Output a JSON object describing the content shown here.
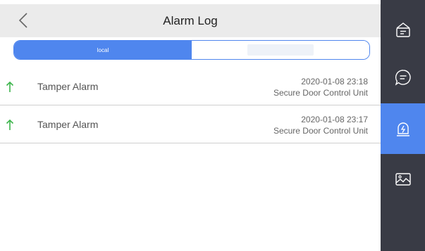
{
  "header": {
    "title": "Alarm Log"
  },
  "tabs": [
    {
      "label": "local",
      "active": true
    },
    {
      "label": "",
      "active": false
    }
  ],
  "alarms": [
    {
      "name": "Tamper Alarm",
      "time": "2020-01-08 23:18",
      "device": "Secure Door Control Unit",
      "icon": "arrow-up-icon"
    },
    {
      "name": "Tamper Alarm",
      "time": "2020-01-08 23:17",
      "device": "Secure Door Control Unit",
      "icon": "arrow-up-icon"
    }
  ],
  "sidebar": {
    "items": [
      {
        "icon": "notice-icon",
        "active": false
      },
      {
        "icon": "message-icon",
        "active": false
      },
      {
        "icon": "alarm-log-icon",
        "active": true
      },
      {
        "icon": "picture-icon",
        "active": false
      }
    ]
  },
  "colors": {
    "accent": "#4f86ee",
    "sidebar": "#393b45",
    "arrow": "#3cb44b"
  }
}
